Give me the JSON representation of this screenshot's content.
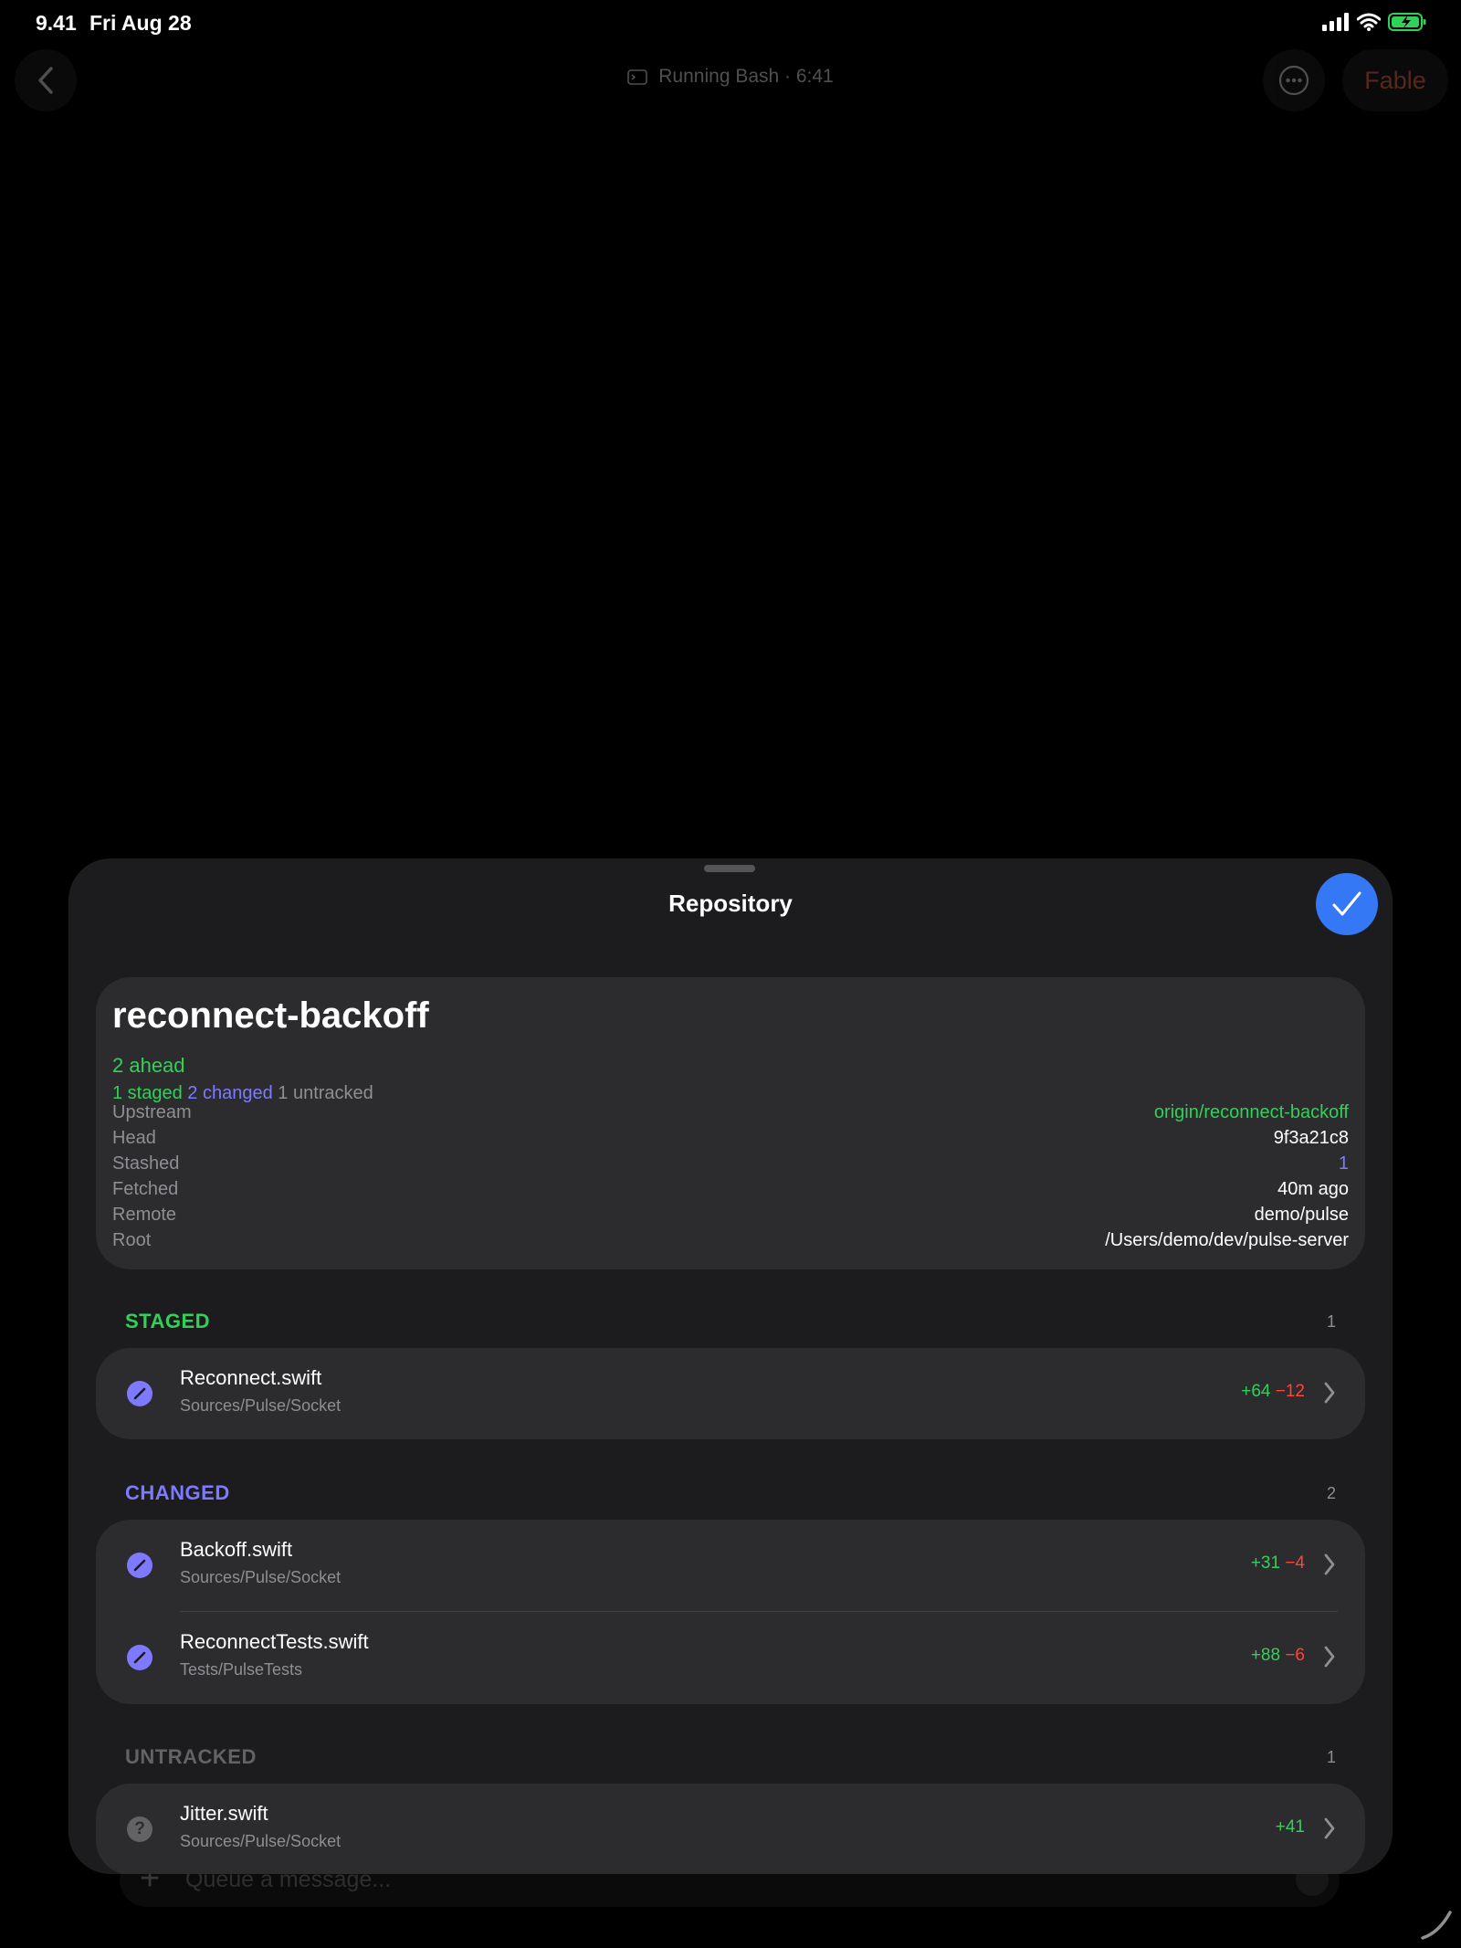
{
  "status_bar": {
    "time": "9.41",
    "date": "Fri Aug 28"
  },
  "top_bar": {
    "title": "Running Bash · 6:41",
    "fable_label": "Fable"
  },
  "composer": {
    "placeholder": "Queue a message..."
  },
  "sheet": {
    "title": "Repository",
    "branch": "reconnect-backoff",
    "ahead": "2 ahead",
    "counts": {
      "staged": "1 staged",
      "changed": "2 changed",
      "untracked": "1 untracked"
    },
    "details": [
      {
        "key": "Upstream",
        "value": "origin/reconnect-backoff",
        "color": "#30d158"
      },
      {
        "key": "Head",
        "value": "9f3a21c8",
        "color": "#ffffff"
      },
      {
        "key": "Stashed",
        "value": "1",
        "color": "#7d7aff"
      },
      {
        "key": "Fetched",
        "value": "40m ago",
        "color": "#ffffff"
      },
      {
        "key": "Remote",
        "value": "demo/pulse",
        "color": "#ffffff"
      },
      {
        "key": "Root",
        "value": "/Users/demo/dev/pulse-server",
        "color": "#ffffff"
      }
    ],
    "sections": {
      "staged": {
        "label": "STAGED",
        "count": "1",
        "files": [
          {
            "name": "Reconnect.swift",
            "path": "Sources/Pulse/Socket",
            "added": "+64",
            "removed": "−12"
          }
        ]
      },
      "changed": {
        "label": "CHANGED",
        "count": "2",
        "files": [
          {
            "name": "Backoff.swift",
            "path": "Sources/Pulse/Socket",
            "added": "+31",
            "removed": "−4"
          },
          {
            "name": "ReconnectTests.swift",
            "path": "Tests/PulseTests",
            "added": "+88",
            "removed": "−6"
          }
        ]
      },
      "untracked": {
        "label": "UNTRACKED",
        "count": "1",
        "files": [
          {
            "name": "Jitter.swift",
            "path": "Sources/Pulse/Socket",
            "added": "+41"
          }
        ]
      }
    }
  },
  "colors": {
    "accent": "#3478f6",
    "staged": "#30d158",
    "changed": "#7d7aff",
    "untracked": "#8e8e93",
    "removed": "#ff453a",
    "fable": "#e2674a"
  },
  "icons": [
    "back-chevron-icon",
    "terminal-icon",
    "more-icon",
    "checkmark-icon",
    "modified-file-icon",
    "untracked-file-icon",
    "chevron-right-icon",
    "signal-icon",
    "wifi-icon",
    "battery-icon"
  ]
}
